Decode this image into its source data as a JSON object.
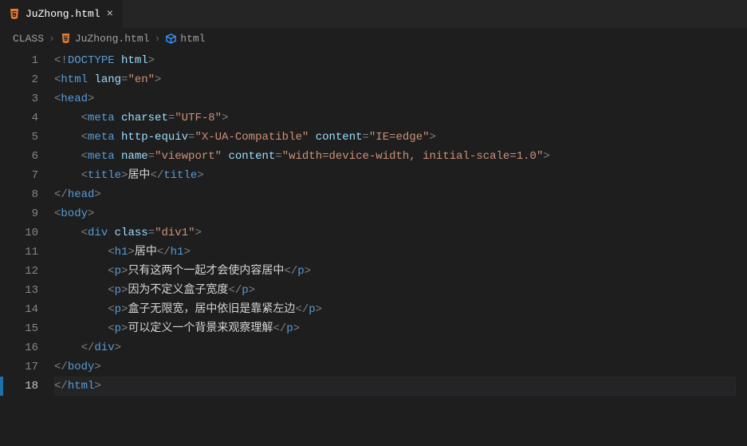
{
  "tab": {
    "filename": "JuZhong.html",
    "close": "×"
  },
  "breadcrumbs": {
    "items": [
      "CLASS",
      "JuZhong.html",
      "html"
    ]
  },
  "editor": {
    "line_count": 18,
    "current_line": 18,
    "lines": [
      {
        "indent": 0,
        "tokens": [
          {
            "t": "pun",
            "v": "<!"
          },
          {
            "t": "doctype",
            "v": "DOCTYPE"
          },
          {
            "t": "txt",
            "v": " "
          },
          {
            "t": "attr",
            "v": "html"
          },
          {
            "t": "pun",
            "v": ">"
          }
        ]
      },
      {
        "indent": 0,
        "tokens": [
          {
            "t": "pun",
            "v": "<"
          },
          {
            "t": "tag",
            "v": "html"
          },
          {
            "t": "txt",
            "v": " "
          },
          {
            "t": "attr",
            "v": "lang"
          },
          {
            "t": "pun",
            "v": "="
          },
          {
            "t": "str",
            "v": "\"en\""
          },
          {
            "t": "pun",
            "v": ">"
          }
        ]
      },
      {
        "indent": 0,
        "tokens": [
          {
            "t": "pun",
            "v": "<"
          },
          {
            "t": "tag",
            "v": "head"
          },
          {
            "t": "pun",
            "v": ">"
          }
        ]
      },
      {
        "indent": 1,
        "tokens": [
          {
            "t": "pun",
            "v": "<"
          },
          {
            "t": "tag",
            "v": "meta"
          },
          {
            "t": "txt",
            "v": " "
          },
          {
            "t": "attr",
            "v": "charset"
          },
          {
            "t": "pun",
            "v": "="
          },
          {
            "t": "str",
            "v": "\"UTF-8\""
          },
          {
            "t": "pun",
            "v": ">"
          }
        ]
      },
      {
        "indent": 1,
        "tokens": [
          {
            "t": "pun",
            "v": "<"
          },
          {
            "t": "tag",
            "v": "meta"
          },
          {
            "t": "txt",
            "v": " "
          },
          {
            "t": "attr",
            "v": "http-equiv"
          },
          {
            "t": "pun",
            "v": "="
          },
          {
            "t": "str",
            "v": "\"X-UA-Compatible\""
          },
          {
            "t": "txt",
            "v": " "
          },
          {
            "t": "attr",
            "v": "content"
          },
          {
            "t": "pun",
            "v": "="
          },
          {
            "t": "str",
            "v": "\"IE=edge\""
          },
          {
            "t": "pun",
            "v": ">"
          }
        ]
      },
      {
        "indent": 1,
        "tokens": [
          {
            "t": "pun",
            "v": "<"
          },
          {
            "t": "tag",
            "v": "meta"
          },
          {
            "t": "txt",
            "v": " "
          },
          {
            "t": "attr",
            "v": "name"
          },
          {
            "t": "pun",
            "v": "="
          },
          {
            "t": "str",
            "v": "\"viewport\""
          },
          {
            "t": "txt",
            "v": " "
          },
          {
            "t": "attr",
            "v": "content"
          },
          {
            "t": "pun",
            "v": "="
          },
          {
            "t": "str",
            "v": "\"width=device-width, initial-scale=1.0\""
          },
          {
            "t": "pun",
            "v": ">"
          }
        ]
      },
      {
        "indent": 1,
        "tokens": [
          {
            "t": "pun",
            "v": "<"
          },
          {
            "t": "tag",
            "v": "title"
          },
          {
            "t": "pun",
            "v": ">"
          },
          {
            "t": "txt",
            "v": "居中"
          },
          {
            "t": "pun",
            "v": "</"
          },
          {
            "t": "tag",
            "v": "title"
          },
          {
            "t": "pun",
            "v": ">"
          }
        ]
      },
      {
        "indent": 0,
        "tokens": [
          {
            "t": "pun",
            "v": "</"
          },
          {
            "t": "tag",
            "v": "head"
          },
          {
            "t": "pun",
            "v": ">"
          }
        ]
      },
      {
        "indent": 0,
        "tokens": [
          {
            "t": "pun",
            "v": "<"
          },
          {
            "t": "tag",
            "v": "body"
          },
          {
            "t": "pun",
            "v": ">"
          }
        ]
      },
      {
        "indent": 1,
        "tokens": [
          {
            "t": "pun",
            "v": "<"
          },
          {
            "t": "tag",
            "v": "div"
          },
          {
            "t": "txt",
            "v": " "
          },
          {
            "t": "attr",
            "v": "class"
          },
          {
            "t": "pun",
            "v": "="
          },
          {
            "t": "str",
            "v": "\"div1\""
          },
          {
            "t": "pun",
            "v": ">"
          }
        ]
      },
      {
        "indent": 2,
        "tokens": [
          {
            "t": "pun",
            "v": "<"
          },
          {
            "t": "tag",
            "v": "h1"
          },
          {
            "t": "pun",
            "v": ">"
          },
          {
            "t": "txt",
            "v": "居中"
          },
          {
            "t": "pun",
            "v": "</"
          },
          {
            "t": "tag",
            "v": "h1"
          },
          {
            "t": "pun",
            "v": ">"
          }
        ]
      },
      {
        "indent": 2,
        "tokens": [
          {
            "t": "pun",
            "v": "<"
          },
          {
            "t": "tag",
            "v": "p"
          },
          {
            "t": "pun",
            "v": ">"
          },
          {
            "t": "txt",
            "v": "只有这两个一起才会使内容居中"
          },
          {
            "t": "pun",
            "v": "</"
          },
          {
            "t": "tag",
            "v": "p"
          },
          {
            "t": "pun",
            "v": ">"
          }
        ]
      },
      {
        "indent": 2,
        "tokens": [
          {
            "t": "pun",
            "v": "<"
          },
          {
            "t": "tag",
            "v": "p"
          },
          {
            "t": "pun",
            "v": ">"
          },
          {
            "t": "txt",
            "v": "因为不定义盒子宽度"
          },
          {
            "t": "pun",
            "v": "</"
          },
          {
            "t": "tag",
            "v": "p"
          },
          {
            "t": "pun",
            "v": ">"
          }
        ]
      },
      {
        "indent": 2,
        "tokens": [
          {
            "t": "pun",
            "v": "<"
          },
          {
            "t": "tag",
            "v": "p"
          },
          {
            "t": "pun",
            "v": ">"
          },
          {
            "t": "txt",
            "v": "盒子无限宽，居中依旧是靠紧左边"
          },
          {
            "t": "pun",
            "v": "</"
          },
          {
            "t": "tag",
            "v": "p"
          },
          {
            "t": "pun",
            "v": ">"
          }
        ]
      },
      {
        "indent": 2,
        "tokens": [
          {
            "t": "pun",
            "v": "<"
          },
          {
            "t": "tag",
            "v": "p"
          },
          {
            "t": "pun",
            "v": ">"
          },
          {
            "t": "txt",
            "v": "可以定义一个背景来观察理解"
          },
          {
            "t": "pun",
            "v": "</"
          },
          {
            "t": "tag",
            "v": "p"
          },
          {
            "t": "pun",
            "v": ">"
          }
        ]
      },
      {
        "indent": 1,
        "tokens": [
          {
            "t": "pun",
            "v": "</"
          },
          {
            "t": "tag",
            "v": "div"
          },
          {
            "t": "pun",
            "v": ">"
          }
        ]
      },
      {
        "indent": 0,
        "tokens": [
          {
            "t": "pun",
            "v": "</"
          },
          {
            "t": "tag",
            "v": "body"
          },
          {
            "t": "pun",
            "v": ">"
          }
        ]
      },
      {
        "indent": 0,
        "tokens": [
          {
            "t": "pun",
            "v": "</"
          },
          {
            "t": "tag",
            "v": "html"
          },
          {
            "t": "pun",
            "v": ">"
          }
        ]
      }
    ]
  }
}
